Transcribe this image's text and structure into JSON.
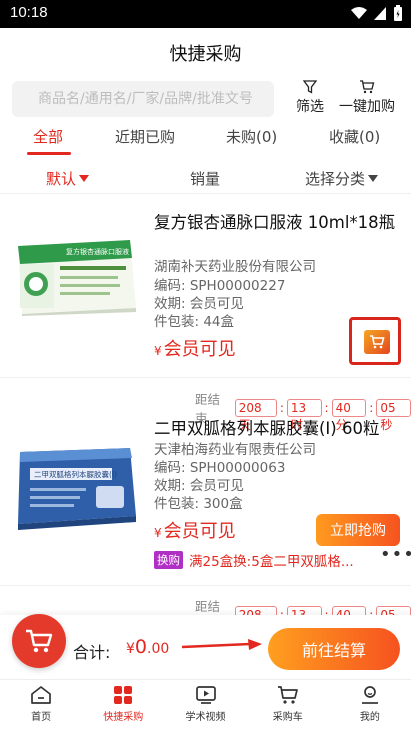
{
  "status_bar": {
    "time": "10:18"
  },
  "header": {
    "title": "快捷采购"
  },
  "search": {
    "placeholder": "商品名/通用名/厂家/品牌/批准文号"
  },
  "header_actions": {
    "filter_label": "筛选",
    "one_click_label": "一键加购"
  },
  "tabs": [
    {
      "label": "全部",
      "active": true
    },
    {
      "label": "近期已购",
      "active": false
    },
    {
      "label": "未购(0)",
      "active": false
    },
    {
      "label": "收藏(0)",
      "active": false
    }
  ],
  "sort": {
    "default_label": "默认",
    "sales_label": "销量",
    "category_label": "选择分类"
  },
  "products": [
    {
      "name": "复方银杏通脉口服液 10ml*18瓶",
      "manufacturer": "湖南补天药业股份有限公司",
      "code": "编码: SPH00000227",
      "validity": "效期: 会员可见",
      "package": "件包装: 44盒",
      "price_symbol": "¥",
      "price": "会员可见",
      "box_text": "复方银杏通脉口服液"
    },
    {
      "countdown_label": "距结束",
      "countdown": {
        "days": "208天",
        "hours": "13时",
        "minutes": "40分",
        "seconds": "05秒"
      },
      "name": "二甲双胍格列本脲胶囊(I) 60粒",
      "manufacturer": "天津柏海药业有限责任公司",
      "code": "编码: SPH00000063",
      "validity": "效期: 会员可见",
      "package": "件包装: 300盒",
      "price_symbol": "¥",
      "price": "会员可见",
      "buy_label": "立即抢购",
      "promo_badge": "换购",
      "promo_text": "满25盒换:5盒二甲双胍格...",
      "more": "•••",
      "box_text": "二甲双胍格列本脲胶囊(I)"
    },
    {
      "countdown_label": "距结束",
      "countdown": {
        "days": "208天",
        "hours": "13时",
        "minutes": "40分",
        "seconds": "05秒"
      }
    }
  ],
  "footer": {
    "total_label": "合计:",
    "total_symbol": "¥",
    "total_int": "0",
    "total_dec": ".00",
    "checkout_label": "前往结算"
  },
  "tabbar": [
    {
      "label": "首页",
      "icon": "home-icon",
      "active": false
    },
    {
      "label": "快捷采购",
      "icon": "grid-icon",
      "active": true
    },
    {
      "label": "学术视频",
      "icon": "video-icon",
      "active": false
    },
    {
      "label": "采购车",
      "icon": "cart-icon",
      "active": false
    },
    {
      "label": "我的",
      "icon": "user-icon",
      "active": false
    }
  ],
  "colors": {
    "accent": "#e2281f",
    "orange": "#f6531f"
  }
}
